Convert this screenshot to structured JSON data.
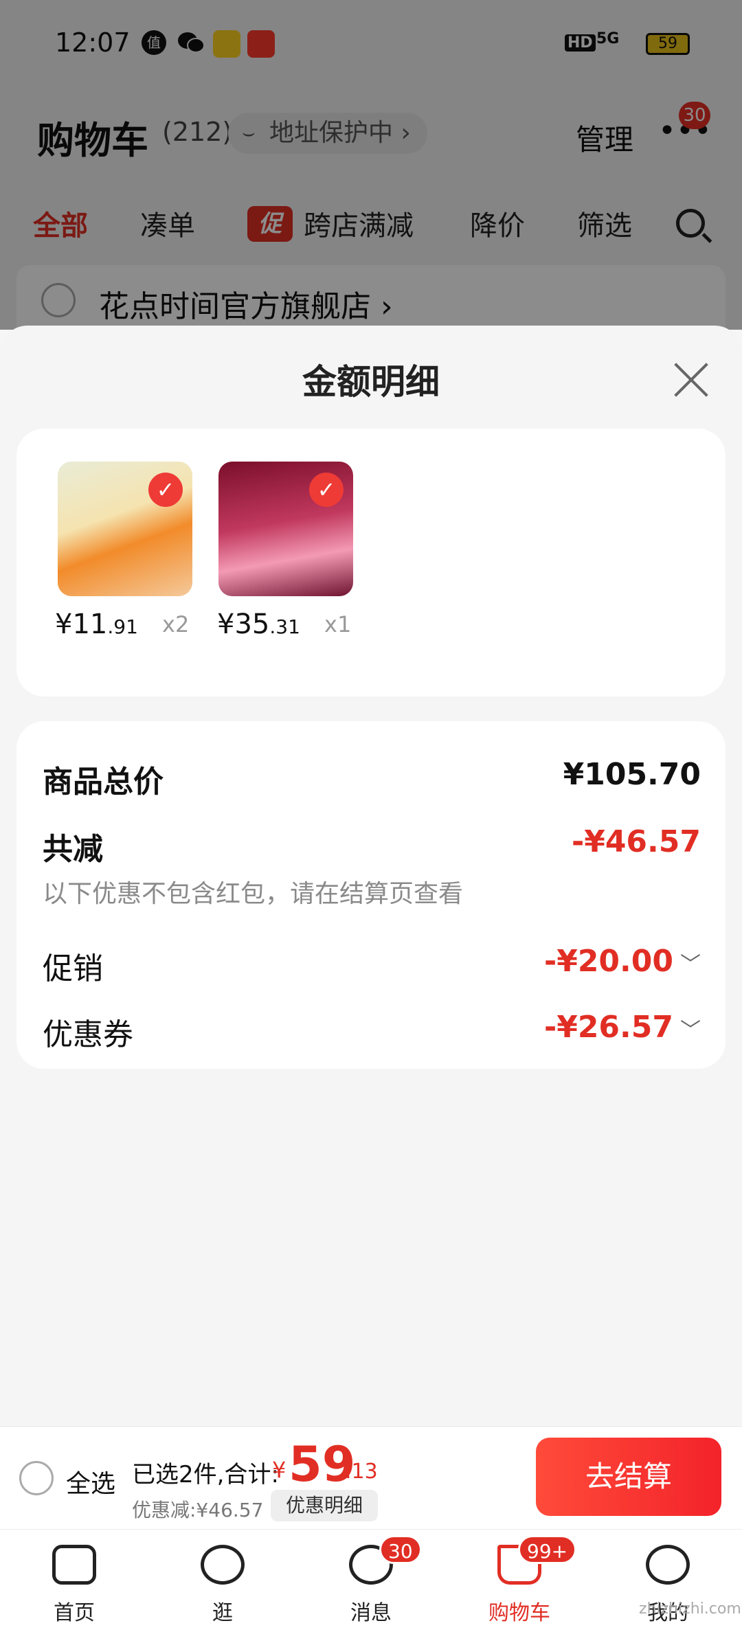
{
  "status_bar": {
    "time": "12:07",
    "app_icon_1": "值",
    "hd": "HD",
    "signal": "5G",
    "battery": "59"
  },
  "header": {
    "title": "购物车",
    "count": "(212)",
    "address_protect": "地址保护中 ›",
    "manage": "管理",
    "more_badge": "30"
  },
  "tabs": {
    "all": "全部",
    "coudan": "凑单",
    "cu_badge": "促",
    "cross_store": "跨店满减",
    "price_drop": "降价",
    "filter": "筛选"
  },
  "store": {
    "name": "花点时间官方旗舰店 ›"
  },
  "sheet": {
    "title": "金额明细",
    "items": [
      {
        "price_int": "¥11",
        "price_dec": ".91",
        "qty": "x2"
      },
      {
        "price_int": "¥35",
        "price_dec": ".31",
        "qty": "x1"
      }
    ],
    "summary": {
      "total_label": "商品总价",
      "total_value": "¥105.70",
      "reduce_label": "共减",
      "reduce_value": "-¥46.57",
      "hint": "以下优惠不包含红包，请在结算页查看",
      "promo_label": "促销",
      "promo_value": "-¥20.00",
      "coupon_label": "优惠券",
      "coupon_value": "-¥26.57"
    }
  },
  "checkout": {
    "select_all": "全选",
    "selected_text": "已选2件,合计:",
    "yen": "¥",
    "total_int": "59",
    "total_dec": ".13",
    "saved": "优惠减:¥46.57",
    "detail": "优惠明细",
    "button": "去结算"
  },
  "tabbar": {
    "home": "首页",
    "browse": "逛",
    "messages": "消息",
    "messages_badge": "30",
    "cart": "购物车",
    "cart_badge": "99+",
    "me": "我的"
  },
  "watermark": "zhizhizhi.com",
  "colors": {
    "accent": "#e12e24",
    "checkout_button": "#f3232a"
  }
}
